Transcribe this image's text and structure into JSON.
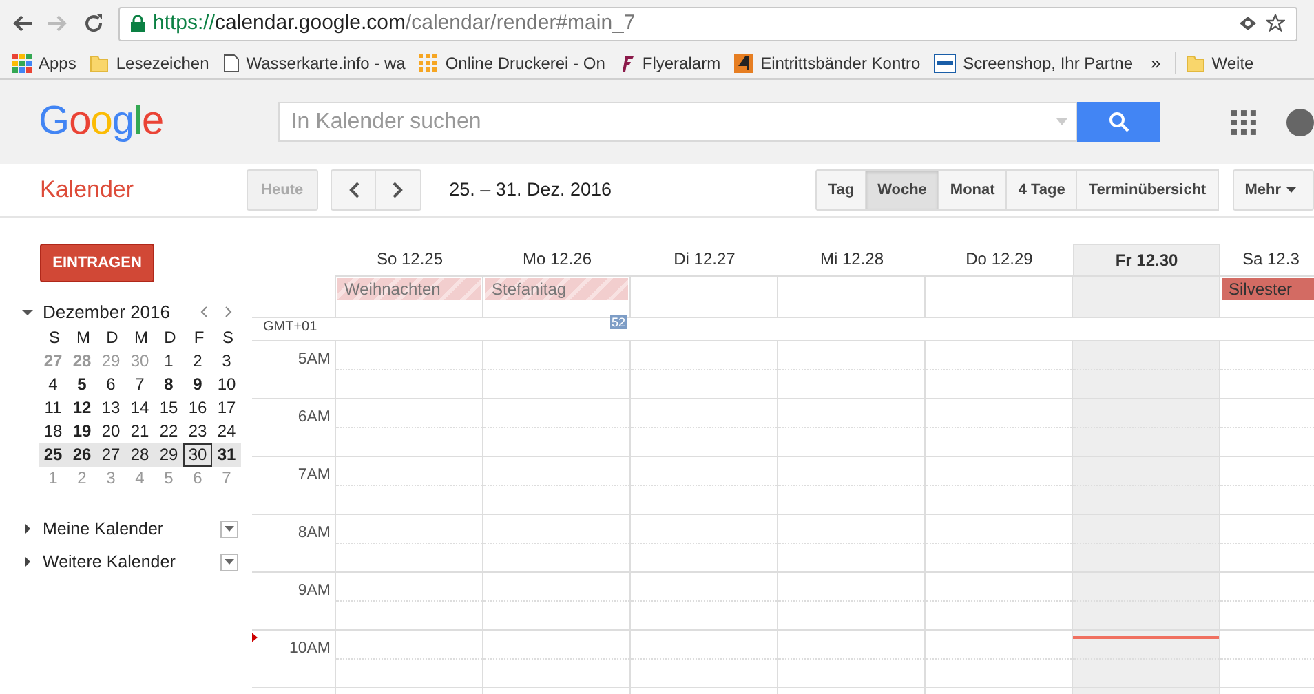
{
  "browser": {
    "url": {
      "scheme": "https://",
      "host": "calendar.google.com",
      "path": "/calendar/render#main_7"
    },
    "bookmarks": [
      {
        "label": "Apps",
        "kind": "apps"
      },
      {
        "label": "Lesezeichen",
        "kind": "folder"
      },
      {
        "label": "Wasserkarte.info - wa",
        "kind": "page"
      },
      {
        "label": "Online Druckerei - On",
        "kind": "dots"
      },
      {
        "label": "Flyeralarm",
        "kind": "f"
      },
      {
        "label": "Eintrittsbänder Kontro",
        "kind": "four"
      },
      {
        "label": "Screenshop, Ihr Partne",
        "kind": "screen"
      }
    ],
    "overflow": "»",
    "trailing_bookmark": {
      "label": "Weite",
      "kind": "folder"
    }
  },
  "header": {
    "logo": "Google",
    "search": {
      "placeholder": "In Kalender suchen"
    }
  },
  "toolbar": {
    "app_title": "Kalender",
    "today_button": {
      "label": "Heute",
      "disabled": true
    },
    "date_range": "25. – 31. Dez. 2016",
    "views": [
      {
        "label": "Tag",
        "selected": false
      },
      {
        "label": "Woche",
        "selected": true
      },
      {
        "label": "Monat",
        "selected": false
      },
      {
        "label": "4 Tage",
        "selected": false
      },
      {
        "label": "Terminübersicht",
        "selected": false
      }
    ],
    "more": "Mehr"
  },
  "sidebar": {
    "create_button": "EINTRAGEN",
    "mini_calendar": {
      "title": "Dezember 2016",
      "expanded": true,
      "weekdays": [
        "S",
        "M",
        "D",
        "M",
        "D",
        "F",
        "S"
      ],
      "weeks": [
        {
          "selected": false,
          "days": [
            {
              "day": "27",
              "kind": "other",
              "bold": true,
              "today": false
            },
            {
              "day": "28",
              "kind": "other",
              "bold": true,
              "today": false
            },
            {
              "day": "29",
              "kind": "other",
              "bold": false,
              "today": false
            },
            {
              "day": "30",
              "kind": "other",
              "bold": false,
              "today": false
            },
            {
              "day": "1",
              "kind": "current",
              "bold": false,
              "today": false
            },
            {
              "day": "2",
              "kind": "current",
              "bold": false,
              "today": false
            },
            {
              "day": "3",
              "kind": "current",
              "bold": false,
              "today": false
            }
          ]
        },
        {
          "selected": false,
          "days": [
            {
              "day": "4",
              "kind": "current",
              "bold": false,
              "today": false
            },
            {
              "day": "5",
              "kind": "current",
              "bold": true,
              "today": false
            },
            {
              "day": "6",
              "kind": "current",
              "bold": false,
              "today": false
            },
            {
              "day": "7",
              "kind": "current",
              "bold": false,
              "today": false
            },
            {
              "day": "8",
              "kind": "current",
              "bold": true,
              "today": false
            },
            {
              "day": "9",
              "kind": "current",
              "bold": true,
              "today": false
            },
            {
              "day": "10",
              "kind": "current",
              "bold": false,
              "today": false
            }
          ]
        },
        {
          "selected": false,
          "days": [
            {
              "day": "11",
              "kind": "current",
              "bold": false,
              "today": false
            },
            {
              "day": "12",
              "kind": "current",
              "bold": true,
              "today": false
            },
            {
              "day": "13",
              "kind": "current",
              "bold": false,
              "today": false
            },
            {
              "day": "14",
              "kind": "current",
              "bold": false,
              "today": false
            },
            {
              "day": "15",
              "kind": "current",
              "bold": false,
              "today": false
            },
            {
              "day": "16",
              "kind": "current",
              "bold": false,
              "today": false
            },
            {
              "day": "17",
              "kind": "current",
              "bold": false,
              "today": false
            }
          ]
        },
        {
          "selected": false,
          "days": [
            {
              "day": "18",
              "kind": "current",
              "bold": false,
              "today": false
            },
            {
              "day": "19",
              "kind": "current",
              "bold": true,
              "today": false
            },
            {
              "day": "20",
              "kind": "current",
              "bold": false,
              "today": false
            },
            {
              "day": "21",
              "kind": "current",
              "bold": false,
              "today": false
            },
            {
              "day": "22",
              "kind": "current",
              "bold": false,
              "today": false
            },
            {
              "day": "23",
              "kind": "current",
              "bold": false,
              "today": false
            },
            {
              "day": "24",
              "kind": "current",
              "bold": false,
              "today": false
            }
          ]
        },
        {
          "selected": true,
          "days": [
            {
              "day": "25",
              "kind": "current",
              "bold": true,
              "today": false
            },
            {
              "day": "26",
              "kind": "current",
              "bold": true,
              "today": false
            },
            {
              "day": "27",
              "kind": "current",
              "bold": false,
              "today": false
            },
            {
              "day": "28",
              "kind": "current",
              "bold": false,
              "today": false
            },
            {
              "day": "29",
              "kind": "current",
              "bold": false,
              "today": false
            },
            {
              "day": "30",
              "kind": "current",
              "bold": false,
              "today": true
            },
            {
              "day": "31",
              "kind": "current",
              "bold": true,
              "today": false
            }
          ]
        },
        {
          "selected": false,
          "days": [
            {
              "day": "1",
              "kind": "other",
              "bold": false,
              "today": false
            },
            {
              "day": "2",
              "kind": "other",
              "bold": false,
              "today": false
            },
            {
              "day": "3",
              "kind": "other",
              "bold": false,
              "today": false
            },
            {
              "day": "4",
              "kind": "other",
              "bold": false,
              "today": false
            },
            {
              "day": "5",
              "kind": "other",
              "bold": false,
              "today": false
            },
            {
              "day": "6",
              "kind": "other",
              "bold": false,
              "today": false
            },
            {
              "day": "7",
              "kind": "other",
              "bold": false,
              "today": false
            }
          ]
        }
      ]
    },
    "calendar_lists": [
      {
        "label": "Meine Kalender",
        "expanded": false
      },
      {
        "label": "Weitere Kalender",
        "expanded": false
      }
    ]
  },
  "grid": {
    "timezone": "GMT+01",
    "week_number": "52",
    "days": [
      {
        "label": "So 12.25",
        "today": false,
        "events": [
          {
            "title": "Weihnachten",
            "past": true
          }
        ]
      },
      {
        "label": "Mo 12.26",
        "today": false,
        "events": [
          {
            "title": "Stefanitag",
            "past": true
          }
        ]
      },
      {
        "label": "Di 12.27",
        "today": false
      },
      {
        "label": "Mi 12.28",
        "today": false
      },
      {
        "label": "Do 12.29",
        "today": false
      },
      {
        "label": "Fr 12.30",
        "today": true
      },
      {
        "label": "Sa 12.3",
        "today": false,
        "events": [
          {
            "title": "Silvester",
            "past": false
          }
        ]
      }
    ],
    "hours": [
      "5AM",
      "6AM",
      "7AM",
      "8AM",
      "9AM",
      "10AM"
    ]
  }
}
